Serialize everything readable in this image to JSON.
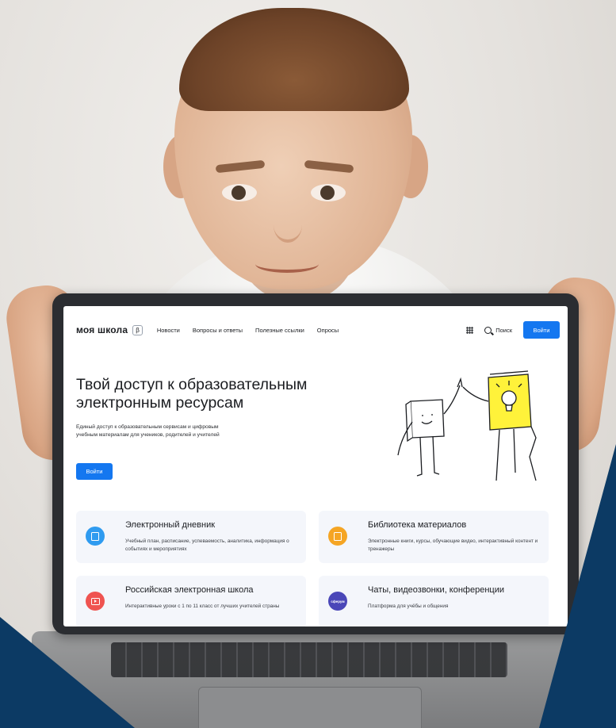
{
  "site": {
    "logo": "моя школа",
    "beta": "β",
    "nav": [
      "Новости",
      "Вопросы и ответы",
      "Полезные ссылки",
      "Опросы"
    ],
    "search_label": "Поиск",
    "login_label": "Войти"
  },
  "hero": {
    "title": "Твой доступ к образовательным электронным ресурсам",
    "subtitle": "Единый доступ к образовательным сервисам и цифровым учебным материалам для учеников, родителей и учителей",
    "button": "Войти"
  },
  "cards": [
    {
      "title": "Электронный дневник",
      "description": "Учебный план, расписание, успеваемость, аналитика, информация о событиях и мероприятиях",
      "icon": "diary-icon",
      "color": "#2f9bf0"
    },
    {
      "title": "Библиотека материалов",
      "description": "Электронные книги, курсы, обучающие видео, интерактивный контент и тренажеры",
      "icon": "books-icon",
      "color": "#f5a524"
    },
    {
      "title": "Российская электронная школа",
      "description": "Интерактивные уроки с 1 по 11 класс от лучших учителей страны",
      "icon": "video-lesson-icon",
      "color": "#ef5350"
    },
    {
      "title": "Чаты, видеозвонки, конференции",
      "description": "Платформа для учёбы и общения",
      "icon": "sferum-icon",
      "icon_text": "сферум",
      "color": "#4a47b8"
    }
  ],
  "colors": {
    "primary_button": "#1477f0",
    "card_background": "#f4f6fb",
    "corner_navy": "#0c3a64",
    "highlight_yellow": "#fff23a"
  }
}
